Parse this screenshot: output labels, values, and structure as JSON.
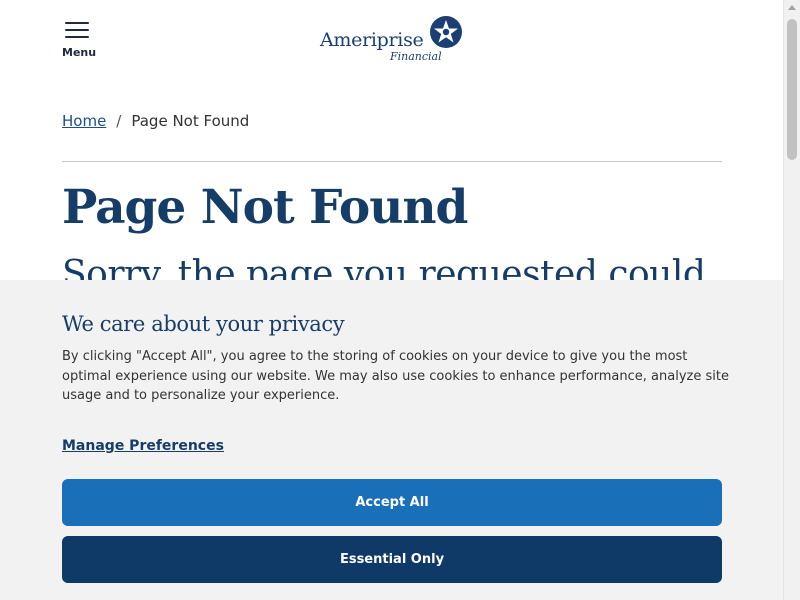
{
  "header": {
    "menu_label": "Menu",
    "menu_icon": "hamburger-icon",
    "logo": {
      "brand": "Ameriprise",
      "sub": "Financial",
      "icon": "star-emblem-icon",
      "color": "#1b3f73"
    }
  },
  "breadcrumb": {
    "home_label": "Home",
    "separator": "/",
    "current": "Page Not Found"
  },
  "main": {
    "title": "Page Not Found",
    "subtitle": "Sorry, the page you requested could"
  },
  "cookie_banner": {
    "title": "We care about your privacy",
    "text": "By clicking \"Accept All\", you agree to the storing of cookies on your device to give you the most optimal experience using our website. We may also use cookies to enhance performance, analyze site usage and to personalize your experience.",
    "manage_label": "Manage Preferences",
    "accept_label": "Accept All",
    "essential_label": "Essential Only"
  },
  "colors": {
    "brand_navy": "#163d68",
    "accept_blue": "#1a70b8",
    "essential_navy": "#0f3a68",
    "banner_bg": "#f2f2f2"
  }
}
